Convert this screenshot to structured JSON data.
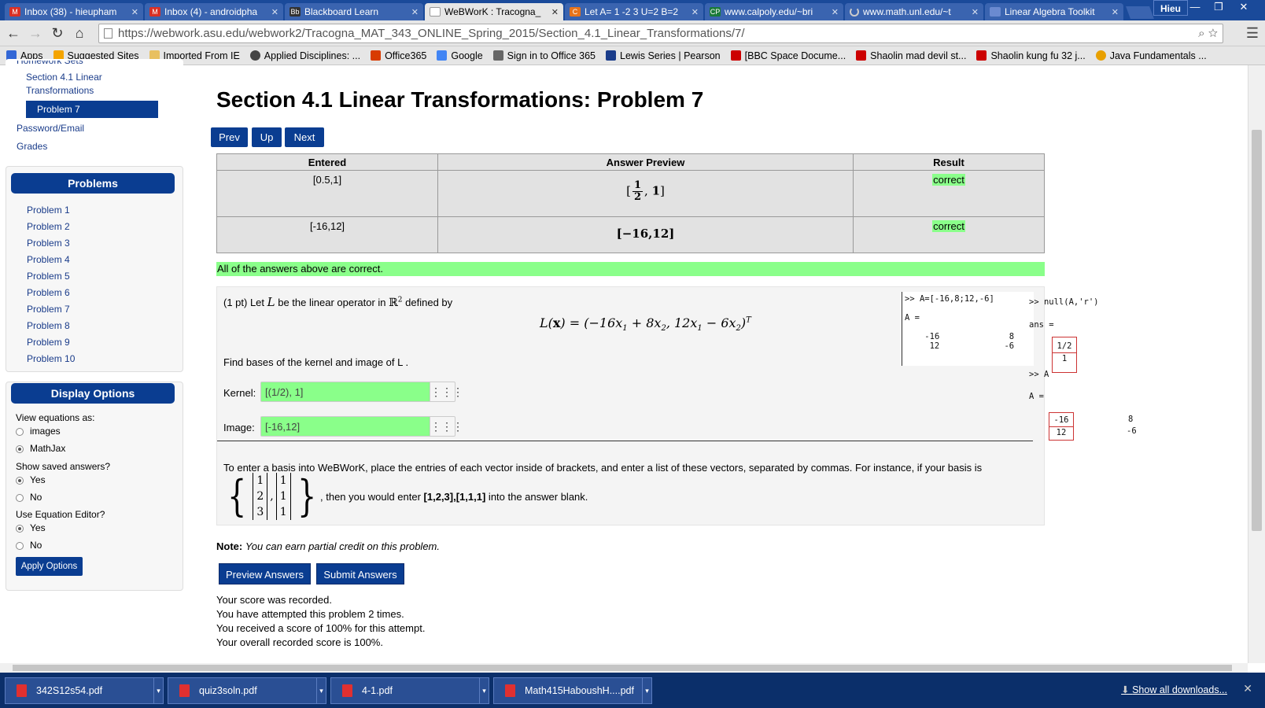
{
  "browser": {
    "tabs": [
      {
        "title": "Inbox (38) - hieupham",
        "icon": "gmail-icon",
        "color": "#d93025"
      },
      {
        "title": "Inbox (4) - androidpha",
        "icon": "gmail-icon",
        "color": "#d93025"
      },
      {
        "title": "Blackboard Learn",
        "icon": "blackboard-icon",
        "color": "#333333"
      },
      {
        "title": "WeBWorK : Tracogna_",
        "icon": "page-icon",
        "color": "#ffffff",
        "active": true
      },
      {
        "title": "Let A= 1 -2 3 U=2 B=2",
        "icon": "chegg-icon",
        "color": "#e8731a"
      },
      {
        "title": "www.calpoly.edu/~bri",
        "icon": "calpoly-icon",
        "color": "#1a7a3a"
      },
      {
        "title": "www.math.unl.edu/~t",
        "icon": "loading-icon",
        "color": "#3a64b0"
      },
      {
        "title": "Linear Algebra Toolkit",
        "icon": "page-icon",
        "color": "#3a64b0"
      }
    ],
    "user": "Hieu",
    "url_host": "https://webwork.asu.edu",
    "url_path": "/webwork2/Tracogna_MAT_343_ONLINE_Spring_2015/Section_4.1_Linear_Transformations/7/",
    "bookmarks": [
      {
        "label": "Apps",
        "icon": "apps-icon",
        "color": "#3367d6"
      },
      {
        "label": "Suggested Sites",
        "icon": "suggested-icon",
        "color": "#f4a400"
      },
      {
        "label": "Imported From IE",
        "icon": "folder-icon",
        "color": "#e8c060"
      },
      {
        "label": "Applied Disciplines: ...",
        "icon": "site-icon",
        "color": "#444444"
      },
      {
        "label": "Office365",
        "icon": "office-icon",
        "color": "#d83b01"
      },
      {
        "label": "Google",
        "icon": "google-icon",
        "color": "#4285f4"
      },
      {
        "label": "Sign in to Office 365",
        "icon": "office-icon",
        "color": "#666666"
      },
      {
        "label": "Lewis Series | Pearson",
        "icon": "pearson-icon",
        "color": "#1a3c8a"
      },
      {
        "label": "[BBC Space Docume...",
        "icon": "youtube-icon",
        "color": "#cc0000"
      },
      {
        "label": "Shaolin mad devil st...",
        "icon": "youtube-icon",
        "color": "#cc0000"
      },
      {
        "label": "Shaolin kung fu 32 j...",
        "icon": "youtube-icon",
        "color": "#cc0000"
      },
      {
        "label": "Java Fundamentals ...",
        "icon": "java-icon",
        "color": "#e8a000"
      }
    ]
  },
  "sidebar": {
    "top_link": "Homework Sets",
    "section_link": "Section 4.1 Linear Transformations",
    "current_problem": "Problem 7",
    "password_link": "Password/Email",
    "grades_link": "Grades",
    "problems_heading": "Problems",
    "problems": [
      "Problem 1",
      "Problem 2",
      "Problem 3",
      "Problem 4",
      "Problem 5",
      "Problem 6",
      "Problem 7",
      "Problem 8",
      "Problem 9",
      "Problem 10"
    ],
    "display_heading": "Display Options",
    "view_label": "View equations as:",
    "view_options": [
      "images",
      "MathJax"
    ],
    "saved_label": "Show saved answers?",
    "editor_label": "Use Equation Editor?",
    "yes": "Yes",
    "no": "No",
    "apply": "Apply Options"
  },
  "main": {
    "title": "Section 4.1 Linear Transformations: Problem 7",
    "nav": {
      "prev": "Prev",
      "up": "Up",
      "next": "Next"
    },
    "table": {
      "headers": [
        "Entered",
        "Answer Preview",
        "Result"
      ],
      "rows": [
        {
          "entered": "[0.5,1]",
          "result": "correct"
        },
        {
          "entered": "[-16,12]",
          "preview": "[−16,12]",
          "result": "correct"
        }
      ]
    },
    "all_correct": "All of the answers above are correct.",
    "problem": {
      "intro_a": "(1 pt) Let ",
      "intro_b": " be the linear operator in ",
      "intro_c": " defined by",
      "find": "Find bases of the kernel and image of L .",
      "kernel_label": "Kernel:",
      "kernel_value": "[(1/2), 1]",
      "image_label": "Image:",
      "image_value": "[-16,12]",
      "hint_a": "To enter a basis into WeBWorK, place the entries of each vector inside of brackets, and enter a list of these vectors, separated by commas. For instance, if your basis is",
      "hint_b": ", then you would enter ",
      "hint_example": "[1,2,3],[1,1,1]",
      "hint_c": " into the answer blank."
    },
    "note_label": "Note:",
    "note_text": "You can earn partial credit on this problem.",
    "preview_button": "Preview Answers",
    "submit_button": "Submit Answers",
    "status": [
      "Your score was recorded.",
      "You have attempted this problem 2 times.",
      "You received a score of 100% for this attempt.",
      "Your overall recorded score is 100%."
    ],
    "matlab": {
      "cmd1": ">> A=[-16,8;12,-6]",
      "a_eq": "A =",
      "row1": [
        "-16",
        "8"
      ],
      "row2": [
        "12",
        "-6"
      ],
      "cmd2": ">> null(A,'r')",
      "ans_eq": "ans =",
      "null1": "1/2",
      "null2": "1",
      "cmd3": ">> A"
    }
  },
  "downloads": {
    "files": [
      "342S12s54.pdf",
      "quiz3soln.pdf",
      "4-1.pdf",
      "Math415HaboushH....pdf"
    ],
    "show_all": "Show all downloads..."
  }
}
